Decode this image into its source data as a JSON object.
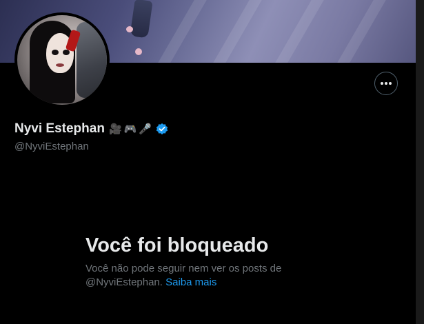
{
  "profile": {
    "display_name": "Nyvi Estephan",
    "name_emojis": [
      "🎥",
      "🎮",
      "🎤"
    ],
    "handle": "@NyviEstephan",
    "verified": true,
    "verified_icon": "verified-badge-icon"
  },
  "actions": {
    "more_icon": "more-dots-icon"
  },
  "blocked": {
    "title": "Você foi bloqueado",
    "text_line1": "Você não pode seguir nem ver os posts de",
    "text_handle": "@NyviEstephan.",
    "learn_more": "Saiba mais"
  },
  "colors": {
    "background": "#000000",
    "primary_text": "#e7e9ea",
    "secondary_text": "#71767b",
    "accent": "#1d9bf0"
  }
}
